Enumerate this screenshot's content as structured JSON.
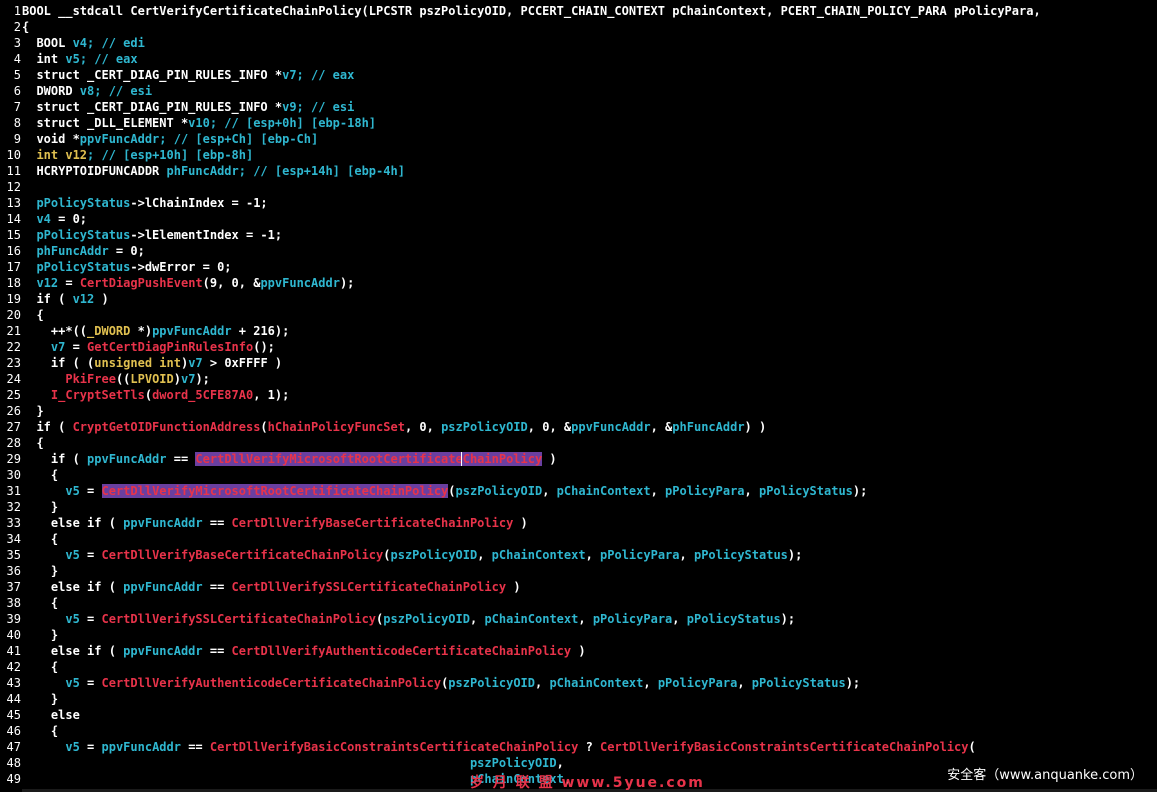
{
  "editor": {
    "lines": [
      {
        "n": "1",
        "segs": [
          [
            "BOOL __stdcall CertVerifyCertificateChainPolicy(LPCSTR pszPolicyOID, PCCERT_CHAIN_CONTEXT pChainContext, PCERT_CHAIN_POLICY_PARA pPolicyPara,",
            "k"
          ]
        ]
      },
      {
        "n": "2",
        "segs": [
          [
            "{",
            "p"
          ]
        ]
      },
      {
        "n": "3",
        "segs": [
          [
            "  BOOL ",
            "t"
          ],
          [
            "v4",
            "v"
          ],
          [
            "; // edi",
            "c"
          ]
        ]
      },
      {
        "n": "4",
        "segs": [
          [
            "  int ",
            "t"
          ],
          [
            "v5",
            "v"
          ],
          [
            "; // eax",
            "c"
          ]
        ]
      },
      {
        "n": "5",
        "segs": [
          [
            "  struct _CERT_DIAG_PIN_RULES_INFO *",
            "t"
          ],
          [
            "v7",
            "v"
          ],
          [
            "; // eax",
            "c"
          ]
        ]
      },
      {
        "n": "6",
        "segs": [
          [
            "  DWORD ",
            "t"
          ],
          [
            "v8",
            "v"
          ],
          [
            "; // esi",
            "c"
          ]
        ]
      },
      {
        "n": "7",
        "segs": [
          [
            "  struct _CERT_DIAG_PIN_RULES_INFO *",
            "t"
          ],
          [
            "v9",
            "v"
          ],
          [
            "; // esi",
            "c"
          ]
        ]
      },
      {
        "n": "8",
        "segs": [
          [
            "  struct _DLL_ELEMENT *",
            "t"
          ],
          [
            "v10",
            "v"
          ],
          [
            "; // [esp+0h] [ebp-18h]",
            "c"
          ]
        ]
      },
      {
        "n": "9",
        "segs": [
          [
            "  void *",
            "t"
          ],
          [
            "ppvFuncAddr",
            "v"
          ],
          [
            "; // [esp+Ch] [ebp-Ch]",
            "c"
          ]
        ]
      },
      {
        "n": "10",
        "segs": [
          [
            "  int ",
            "y"
          ],
          [
            "v12",
            "y"
          ],
          [
            "; // [esp+10h] [ebp-8h]",
            "c"
          ]
        ]
      },
      {
        "n": "11",
        "segs": [
          [
            "  HCRYPTOIDFUNCADDR ",
            "t"
          ],
          [
            "phFuncAddr",
            "v"
          ],
          [
            "; // [esp+14h] [ebp-4h]",
            "c"
          ]
        ]
      },
      {
        "n": "12",
        "segs": [
          [
            "",
            "p"
          ]
        ]
      },
      {
        "n": "13",
        "segs": [
          [
            "  ",
            "p"
          ],
          [
            "pPolicyStatus",
            "v"
          ],
          [
            "->lChainIndex = -1;",
            "p"
          ]
        ]
      },
      {
        "n": "14",
        "segs": [
          [
            "  ",
            "p"
          ],
          [
            "v4",
            "v"
          ],
          [
            " = 0;",
            "p"
          ]
        ]
      },
      {
        "n": "15",
        "segs": [
          [
            "  ",
            "p"
          ],
          [
            "pPolicyStatus",
            "v"
          ],
          [
            "->lElementIndex = -1;",
            "p"
          ]
        ]
      },
      {
        "n": "16",
        "segs": [
          [
            "  ",
            "p"
          ],
          [
            "phFuncAddr",
            "v"
          ],
          [
            " = 0;",
            "p"
          ]
        ]
      },
      {
        "n": "17",
        "segs": [
          [
            "  ",
            "p"
          ],
          [
            "pPolicyStatus",
            "v"
          ],
          [
            "->dwError = 0;",
            "p"
          ]
        ]
      },
      {
        "n": "18",
        "segs": [
          [
            "  ",
            "p"
          ],
          [
            "v12",
            "v"
          ],
          [
            " = ",
            "p"
          ],
          [
            "CertDiagPushEvent",
            "f"
          ],
          [
            "(9, 0, &",
            "p"
          ],
          [
            "ppvFuncAddr",
            "v"
          ],
          [
            ");",
            "p"
          ]
        ]
      },
      {
        "n": "19",
        "segs": [
          [
            "  if ( ",
            "p"
          ],
          [
            "v12",
            "v"
          ],
          [
            " )",
            "p"
          ]
        ]
      },
      {
        "n": "20",
        "segs": [
          [
            "  {",
            "p"
          ]
        ]
      },
      {
        "n": "21",
        "segs": [
          [
            "    ++*((",
            "p"
          ],
          [
            "_DWORD",
            "y"
          ],
          [
            " *)",
            "p"
          ],
          [
            "ppvFuncAddr",
            "v"
          ],
          [
            " + 216);",
            "p"
          ]
        ]
      },
      {
        "n": "22",
        "segs": [
          [
            "    ",
            "p"
          ],
          [
            "v7",
            "v"
          ],
          [
            " = ",
            "p"
          ],
          [
            "GetCertDiagPinRulesInfo",
            "f"
          ],
          [
            "();",
            "p"
          ]
        ]
      },
      {
        "n": "23",
        "segs": [
          [
            "    if ( (",
            "p"
          ],
          [
            "unsigned int",
            "y"
          ],
          [
            ")",
            "p"
          ],
          [
            "v7",
            "v"
          ],
          [
            " > 0xFFFF )",
            "p"
          ]
        ]
      },
      {
        "n": "24",
        "segs": [
          [
            "      ",
            "p"
          ],
          [
            "PkiFree",
            "f"
          ],
          [
            "((",
            "p"
          ],
          [
            "LPVOID",
            "y"
          ],
          [
            ")",
            "p"
          ],
          [
            "v7",
            "v"
          ],
          [
            ");",
            "p"
          ]
        ]
      },
      {
        "n": "25",
        "segs": [
          [
            "    ",
            "p"
          ],
          [
            "I_CryptSetTls",
            "f"
          ],
          [
            "(",
            "p"
          ],
          [
            "dword_5CFE87A0",
            "f"
          ],
          [
            ", 1);",
            "p"
          ]
        ]
      },
      {
        "n": "26",
        "segs": [
          [
            "  }",
            "p"
          ]
        ]
      },
      {
        "n": "27",
        "segs": [
          [
            "  if ( ",
            "p"
          ],
          [
            "CryptGetOIDFunctionAddress",
            "f"
          ],
          [
            "(",
            "p"
          ],
          [
            "hChainPolicyFuncSet",
            "f"
          ],
          [
            ", 0, ",
            "p"
          ],
          [
            "pszPolicyOID",
            "v"
          ],
          [
            ", 0, &",
            "p"
          ],
          [
            "ppvFuncAddr",
            "v"
          ],
          [
            ", &",
            "p"
          ],
          [
            "phFuncAddr",
            "v"
          ],
          [
            ") )",
            "p"
          ]
        ]
      },
      {
        "n": "28",
        "segs": [
          [
            "  {",
            "p"
          ]
        ]
      },
      {
        "n": "29",
        "segs": [
          [
            "    if ( ",
            "p"
          ],
          [
            "ppvFuncAddr",
            "v"
          ],
          [
            " == ",
            "p"
          ],
          [
            "CertDllVerifyMicrosoftRootCertificateChainPolicy",
            "fh"
          ],
          [
            " )",
            "p"
          ]
        ]
      },
      {
        "n": "30",
        "segs": [
          [
            "    {",
            "p"
          ]
        ]
      },
      {
        "n": "31",
        "segs": [
          [
            "      ",
            "p"
          ],
          [
            "v5",
            "v"
          ],
          [
            " = ",
            "p"
          ],
          [
            "CertDllVerifyMicrosoftRootCertificateChainPolicy",
            "fh"
          ],
          [
            "(",
            "p"
          ],
          [
            "pszPolicyOID",
            "v"
          ],
          [
            ", ",
            "p"
          ],
          [
            "pChainContext",
            "v"
          ],
          [
            ", ",
            "p"
          ],
          [
            "pPolicyPara",
            "v"
          ],
          [
            ", ",
            "p"
          ],
          [
            "pPolicyStatus",
            "v"
          ],
          [
            ");",
            "p"
          ]
        ]
      },
      {
        "n": "32",
        "segs": [
          [
            "    }",
            "p"
          ]
        ]
      },
      {
        "n": "33",
        "segs": [
          [
            "    else if ( ",
            "p"
          ],
          [
            "ppvFuncAddr",
            "v"
          ],
          [
            " == ",
            "p"
          ],
          [
            "CertDllVerifyBaseCertificateChainPolicy",
            "f"
          ],
          [
            " )",
            "p"
          ]
        ]
      },
      {
        "n": "34",
        "segs": [
          [
            "    {",
            "p"
          ]
        ]
      },
      {
        "n": "35",
        "segs": [
          [
            "      ",
            "p"
          ],
          [
            "v5",
            "v"
          ],
          [
            " = ",
            "p"
          ],
          [
            "CertDllVerifyBaseCertificateChainPolicy",
            "f"
          ],
          [
            "(",
            "p"
          ],
          [
            "pszPolicyOID",
            "v"
          ],
          [
            ", ",
            "p"
          ],
          [
            "pChainContext",
            "v"
          ],
          [
            ", ",
            "p"
          ],
          [
            "pPolicyPara",
            "v"
          ],
          [
            ", ",
            "p"
          ],
          [
            "pPolicyStatus",
            "v"
          ],
          [
            ");",
            "p"
          ]
        ]
      },
      {
        "n": "36",
        "segs": [
          [
            "    }",
            "p"
          ]
        ]
      },
      {
        "n": "37",
        "segs": [
          [
            "    else if ( ",
            "p"
          ],
          [
            "ppvFuncAddr",
            "v"
          ],
          [
            " == ",
            "p"
          ],
          [
            "CertDllVerifySSLCertificateChainPolicy",
            "f"
          ],
          [
            " )",
            "p"
          ]
        ]
      },
      {
        "n": "38",
        "segs": [
          [
            "    {",
            "p"
          ]
        ]
      },
      {
        "n": "39",
        "segs": [
          [
            "      ",
            "p"
          ],
          [
            "v5",
            "v"
          ],
          [
            " = ",
            "p"
          ],
          [
            "CertDllVerifySSLCertificateChainPolicy",
            "f"
          ],
          [
            "(",
            "p"
          ],
          [
            "pszPolicyOID",
            "v"
          ],
          [
            ", ",
            "p"
          ],
          [
            "pChainContext",
            "v"
          ],
          [
            ", ",
            "p"
          ],
          [
            "pPolicyPara",
            "v"
          ],
          [
            ", ",
            "p"
          ],
          [
            "pPolicyStatus",
            "v"
          ],
          [
            ");",
            "p"
          ]
        ]
      },
      {
        "n": "40",
        "segs": [
          [
            "    }",
            "p"
          ]
        ]
      },
      {
        "n": "41",
        "segs": [
          [
            "    else if ( ",
            "p"
          ],
          [
            "ppvFuncAddr",
            "v"
          ],
          [
            " == ",
            "p"
          ],
          [
            "CertDllVerifyAuthenticodeCertificateChainPolicy",
            "f"
          ],
          [
            " )",
            "p"
          ]
        ]
      },
      {
        "n": "42",
        "segs": [
          [
            "    {",
            "p"
          ]
        ]
      },
      {
        "n": "43",
        "segs": [
          [
            "      ",
            "p"
          ],
          [
            "v5",
            "v"
          ],
          [
            " = ",
            "p"
          ],
          [
            "CertDllVerifyAuthenticodeCertificateChainPolicy",
            "f"
          ],
          [
            "(",
            "p"
          ],
          [
            "pszPolicyOID",
            "v"
          ],
          [
            ", ",
            "p"
          ],
          [
            "pChainContext",
            "v"
          ],
          [
            ", ",
            "p"
          ],
          [
            "pPolicyPara",
            "v"
          ],
          [
            ", ",
            "p"
          ],
          [
            "pPolicyStatus",
            "v"
          ],
          [
            ");",
            "p"
          ]
        ]
      },
      {
        "n": "44",
        "segs": [
          [
            "    }",
            "p"
          ]
        ]
      },
      {
        "n": "45",
        "segs": [
          [
            "    else",
            "p"
          ]
        ]
      },
      {
        "n": "46",
        "segs": [
          [
            "    {",
            "p"
          ]
        ]
      },
      {
        "n": "47",
        "segs": [
          [
            "      ",
            "p"
          ],
          [
            "v5",
            "v"
          ],
          [
            " = ",
            "p"
          ],
          [
            "ppvFuncAddr",
            "v"
          ],
          [
            " == ",
            "p"
          ],
          [
            "CertDllVerifyBasicConstraintsCertificateChainPolicy",
            "f"
          ],
          [
            " ? ",
            "p"
          ],
          [
            "CertDllVerifyBasicConstraintsCertificateChainPolicy",
            "f"
          ],
          [
            "(",
            "p"
          ]
        ]
      },
      {
        "n": "48",
        "segs": [
          [
            "                                                              ",
            "p"
          ],
          [
            "pszPolicyOID",
            "v"
          ],
          [
            ",",
            "p"
          ]
        ]
      },
      {
        "n": "49",
        "segs": [
          [
            "                                                              ",
            "p"
          ],
          [
            "pChainContext",
            "v"
          ],
          [
            ",",
            "p"
          ]
        ]
      }
    ]
  },
  "watermarks": {
    "syue": "岁 月 联 盟  www.5yue.com",
    "anquanke": "安全客（www.anquanke.com）"
  },
  "colors": {
    "background": "#000000",
    "keyword": "#ffffff",
    "variable": "#2fb7d0",
    "type": "#e0c050",
    "function": "#e8334a",
    "highlight": "#6a3fa0"
  }
}
